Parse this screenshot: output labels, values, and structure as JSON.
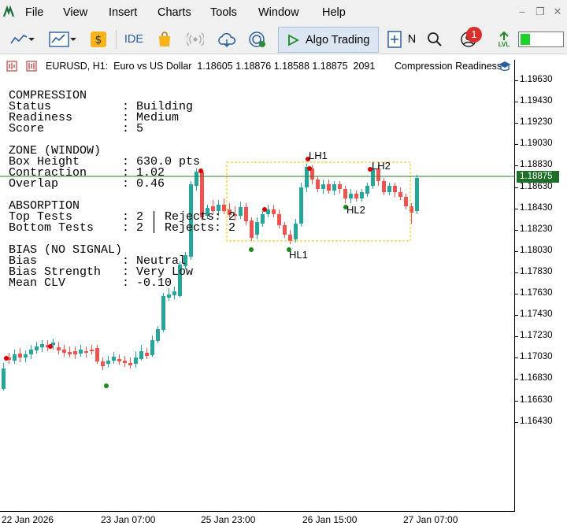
{
  "menubar": {
    "items": [
      "File",
      "View",
      "Insert",
      "Charts",
      "Tools",
      "Window",
      "Help"
    ]
  },
  "toolbar": {
    "ide_label": "IDE",
    "algo_trading_label": "Algo Trading",
    "new_order_label": "N",
    "notification_count": "1",
    "lvl_label": "LVL"
  },
  "chart": {
    "symbol_line": "EURUSD, H1:  Euro vs US Dollar  1.18605 1.18876 1.18588 1.18875  2091",
    "indicator_name": "Compression Readiness",
    "current_price": "1.18875",
    "colors": {
      "bull": "#26a69a",
      "bear": "#ef5350",
      "zone": "#f2c200",
      "marker_red": "#d50000",
      "marker_green": "#1b8a1b",
      "price_line": "#2e7d32"
    }
  },
  "panel": {
    "lines": [
      "COMPRESSION",
      "Status          : Building",
      "Readiness       : Medium",
      "Score           : 5",
      "",
      "ZONE (WINDOW)",
      "Box Height      : 630.0 pts",
      "Contraction     : 1.02",
      "Overlap         : 0.46",
      "",
      "ABSORPTION",
      "Top Tests       : 2 | Rejects: 2",
      "Bottom Tests    : 2 | Rejects: 2",
      "",
      "BIAS (NO SIGNAL)",
      "Bias            : Neutral",
      "Bias Strength   : Very Low",
      "Mean CLV        : -0.10"
    ]
  },
  "swing_labels": {
    "lh1": "LH1",
    "lh2": "LH2",
    "hl1": "HL1",
    "hl2": "HL2"
  },
  "price_axis": [
    "1.19630",
    "1.19430",
    "1.19230",
    "1.19030",
    "1.18830",
    "1.18630",
    "1.18430",
    "1.18230",
    "1.18030",
    "1.17830",
    "1.17630",
    "1.17430",
    "1.17230",
    "1.17030",
    "1.16830",
    "1.16630",
    "1.16430"
  ],
  "time_axis": [
    "22 Jan 2026",
    "23 Jan 07:00",
    "25 Jan 23:00",
    "26 Jan 15:00",
    "27 Jan 07:00"
  ]
}
